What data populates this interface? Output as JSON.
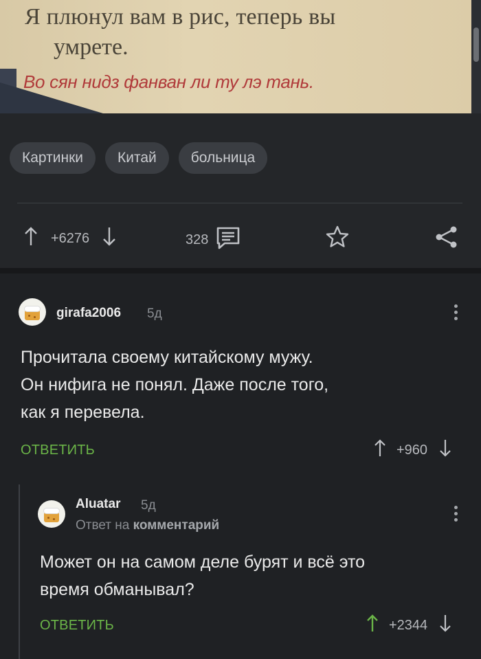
{
  "photo": {
    "line1": "Я плюнул вам в рис, теперь вы",
    "line2": "умрете.",
    "line3": "Во сян нидз фанван ли ту лэ тань."
  },
  "tags": [
    "Картинки",
    "Китай",
    "больница"
  ],
  "post_actions": {
    "rating": "+6276",
    "comments_count": "328"
  },
  "comments": [
    {
      "username": "girafa2006",
      "time": "5д",
      "text_lines": [
        "Прочитала своему китайскому мужу.",
        "Он нифига не понял. Даже после того,",
        "как я перевела."
      ],
      "reply_label": "ОТВЕТИТЬ",
      "rating": "+960"
    },
    {
      "username": "Aluatar",
      "time": "5д",
      "reply_to_prefix": "Ответ на",
      "reply_to_target": "комментарий",
      "text_lines": [
        "Может он на самом деле бурят и всё это",
        "время обманывал?"
      ],
      "reply_label": "ОТВЕТИТЬ",
      "rating": "+2344"
    }
  ],
  "colors": {
    "background": "#1f2124",
    "reply_green": "#6bb548",
    "upvoted_green": "#6bb548"
  },
  "icons": [
    "arrow-up-icon",
    "arrow-down-icon",
    "comments-icon",
    "star-icon",
    "share-icon",
    "kebab-menu-icon",
    "avatar-cake-icon"
  ]
}
